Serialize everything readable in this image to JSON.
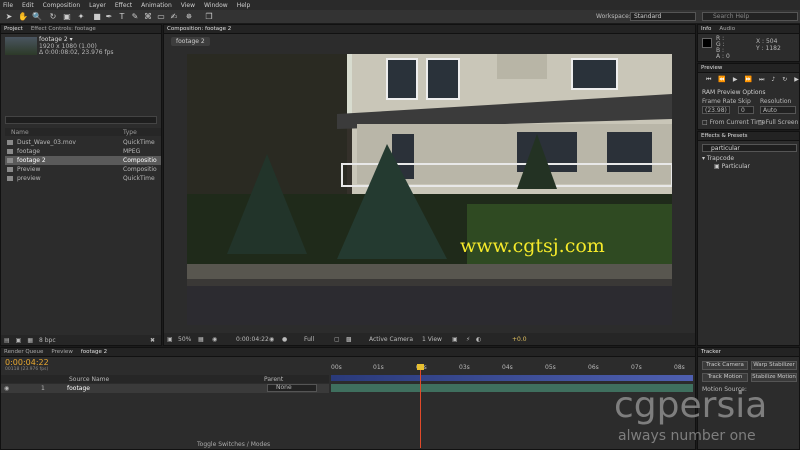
{
  "menu": [
    "File",
    "Edit",
    "Composition",
    "Layer",
    "Effect",
    "Animation",
    "View",
    "Window",
    "Help"
  ],
  "toolbar": {
    "workspace_label": "Workspace:",
    "workspace_value": "Standard",
    "search_placeholder": "Search Help"
  },
  "project": {
    "tabs": [
      "Project",
      "Effect Controls: footage"
    ],
    "item_name": "footage 2 ▾",
    "item_res": "1920 x 1080 (1.00)",
    "item_dur": "Δ 0:00:08:02, 23.976 fps",
    "col_name": "Name",
    "col_type": "Type",
    "rows": [
      {
        "name": "Dust_Wave_03.mov",
        "type": "QuickTime"
      },
      {
        "name": "footage",
        "type": "MPEG"
      },
      {
        "name": "footage 2",
        "type": "Compositio"
      },
      {
        "name": "Preview",
        "type": "Compositio"
      },
      {
        "name": "preview",
        "type": "QuickTime"
      }
    ],
    "bpc": "8 bpc"
  },
  "comp": {
    "tab": "Composition: footage 2",
    "breadcrumb": "footage 2",
    "watermark": "www.cgtsj.com",
    "zoom": "50%",
    "timecode": "0:00:04:22",
    "resolution": "Full",
    "camera": "Active Camera",
    "views": "1 View",
    "offset": "+0.0"
  },
  "info": {
    "tabs": [
      "Info",
      "Audio"
    ],
    "r": "R :",
    "g": "G :",
    "b": "B :",
    "a": "A : 0",
    "x": "X : 504",
    "y": "Y : 1182"
  },
  "preview": {
    "tab": "Preview",
    "ram": "RAM Preview Options",
    "frame_rate": "Frame Rate",
    "skip": "Skip",
    "resolution": "Resolution",
    "fr_value": "(23.98)",
    "skip_value": "0",
    "res_value": "Auto",
    "from_current": "From Current Time",
    "full_screen": "Full Screen"
  },
  "effects": {
    "tab": "Effects & Presets",
    "search": "particular",
    "group": "▾ Trapcode",
    "item": "Particular"
  },
  "tracker": {
    "tab": "Tracker",
    "b1": "Track Camera",
    "b2": "Warp Stabilizer",
    "b3": "Track Motion",
    "b4": "Stabilize Motion",
    "b5": "Motion Source:"
  },
  "timeline": {
    "tabs": [
      "Render Queue",
      "Preview",
      "footage 2"
    ],
    "timecode": "0:00:04:22",
    "frames": "00118 (23.976 fps)",
    "col_source": "Source Name",
    "col_parent": "Parent",
    "layer_num": "1",
    "layer_name": "footage",
    "parent_value": "None",
    "toggle": "Toggle Switches / Modes",
    "ruler": [
      "00s",
      "01s",
      "02s",
      "03s",
      "04s",
      "05s",
      "06s",
      "07s",
      "08s"
    ]
  },
  "logo": {
    "brand": "cgpersia",
    "tagline": "always number one"
  }
}
